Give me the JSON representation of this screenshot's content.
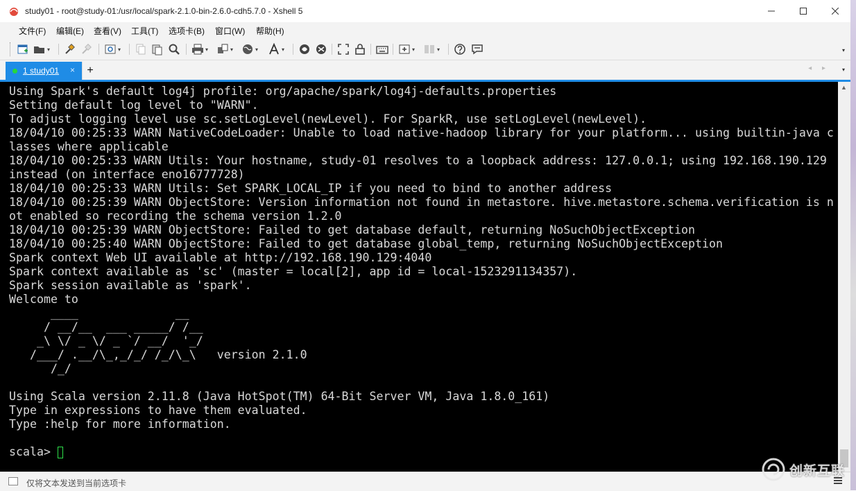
{
  "window": {
    "title": "study01 - root@study-01:/usr/local/spark-2.1.0-bin-2.6.0-cdh5.7.0 - Xshell 5",
    "app_icon": "xshell-icon"
  },
  "menubar": {
    "items": [
      "文件(F)",
      "编辑(E)",
      "查看(V)",
      "工具(T)",
      "选项卡(B)",
      "窗口(W)",
      "帮助(H)"
    ]
  },
  "tabs": [
    {
      "label": "1 study01",
      "status_color": "#27d83a",
      "active": true
    }
  ],
  "tab_add_label": "+",
  "terminal": {
    "lines": [
      "Using Spark's default log4j profile: org/apache/spark/log4j-defaults.properties",
      "Setting default log level to \"WARN\".",
      "To adjust logging level use sc.setLogLevel(newLevel). For SparkR, use setLogLevel(newLevel).",
      "18/04/10 00:25:33 WARN NativeCodeLoader: Unable to load native-hadoop library for your platform... using builtin-java c",
      "lasses where applicable",
      "18/04/10 00:25:33 WARN Utils: Your hostname, study-01 resolves to a loopback address: 127.0.0.1; using 192.168.190.129",
      "instead (on interface eno16777728)",
      "18/04/10 00:25:33 WARN Utils: Set SPARK_LOCAL_IP if you need to bind to another address",
      "18/04/10 00:25:39 WARN ObjectStore: Version information not found in metastore. hive.metastore.schema.verification is n",
      "ot enabled so recording the schema version 1.2.0",
      "18/04/10 00:25:39 WARN ObjectStore: Failed to get database default, returning NoSuchObjectException",
      "18/04/10 00:25:40 WARN ObjectStore: Failed to get database global_temp, returning NoSuchObjectException",
      "Spark context Web UI available at http://192.168.190.129:4040",
      "Spark context available as 'sc' (master = local[2], app id = local-1523291134357).",
      "Spark session available as 'spark'.",
      "Welcome to",
      "      ____              __",
      "     / __/__  ___ _____/ /__",
      "    _\\ \\/ _ \\/ _ `/ __/  '_/",
      "   /___/ .__/\\_,_/_/ /_/\\_\\   version 2.1.0",
      "      /_/",
      "",
      "Using Scala version 2.11.8 (Java HotSpot(TM) 64-Bit Server VM, Java 1.8.0_161)",
      "Type in expressions to have them evaluated.",
      "Type :help for more information.",
      ""
    ],
    "prompt": "scala>",
    "text_color": "#d8d8d8",
    "background": "#000000",
    "cursor_color": "#2ee04a"
  },
  "composebar": {
    "placeholder": "仅将文本发送到当前选项卡"
  },
  "watermark": {
    "text": "创新互联"
  },
  "colors": {
    "accent": "#1f8ce6"
  }
}
